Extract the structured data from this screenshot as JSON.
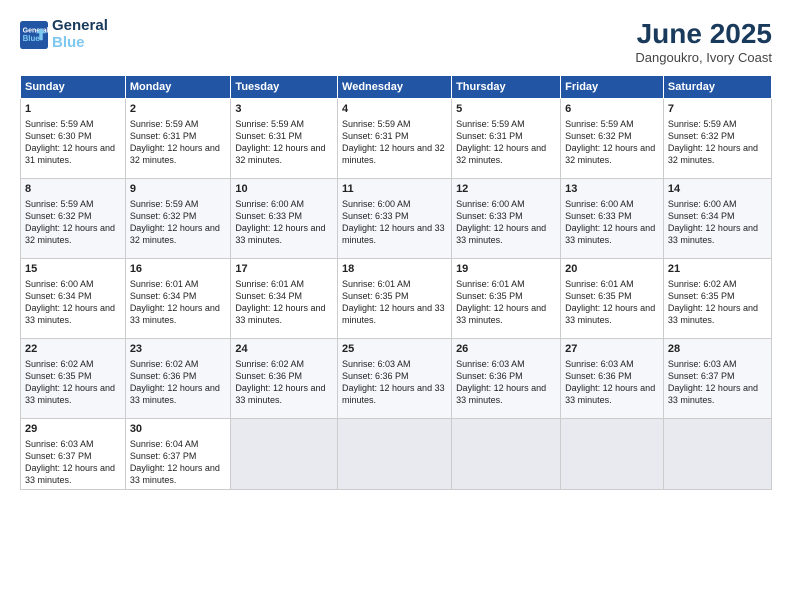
{
  "header": {
    "logo_line1": "General",
    "logo_line2": "Blue",
    "title": "June 2025",
    "subtitle": "Dangoukro, Ivory Coast"
  },
  "days_of_week": [
    "Sunday",
    "Monday",
    "Tuesday",
    "Wednesday",
    "Thursday",
    "Friday",
    "Saturday"
  ],
  "weeks": [
    [
      {
        "day": 1,
        "sunrise": "5:59 AM",
        "sunset": "6:30 PM",
        "daylight": "12 hours and 31 minutes."
      },
      {
        "day": 2,
        "sunrise": "5:59 AM",
        "sunset": "6:31 PM",
        "daylight": "12 hours and 32 minutes."
      },
      {
        "day": 3,
        "sunrise": "5:59 AM",
        "sunset": "6:31 PM",
        "daylight": "12 hours and 32 minutes."
      },
      {
        "day": 4,
        "sunrise": "5:59 AM",
        "sunset": "6:31 PM",
        "daylight": "12 hours and 32 minutes."
      },
      {
        "day": 5,
        "sunrise": "5:59 AM",
        "sunset": "6:31 PM",
        "daylight": "12 hours and 32 minutes."
      },
      {
        "day": 6,
        "sunrise": "5:59 AM",
        "sunset": "6:32 PM",
        "daylight": "12 hours and 32 minutes."
      },
      {
        "day": 7,
        "sunrise": "5:59 AM",
        "sunset": "6:32 PM",
        "daylight": "12 hours and 32 minutes."
      }
    ],
    [
      {
        "day": 8,
        "sunrise": "5:59 AM",
        "sunset": "6:32 PM",
        "daylight": "12 hours and 32 minutes."
      },
      {
        "day": 9,
        "sunrise": "5:59 AM",
        "sunset": "6:32 PM",
        "daylight": "12 hours and 32 minutes."
      },
      {
        "day": 10,
        "sunrise": "6:00 AM",
        "sunset": "6:33 PM",
        "daylight": "12 hours and 33 minutes."
      },
      {
        "day": 11,
        "sunrise": "6:00 AM",
        "sunset": "6:33 PM",
        "daylight": "12 hours and 33 minutes."
      },
      {
        "day": 12,
        "sunrise": "6:00 AM",
        "sunset": "6:33 PM",
        "daylight": "12 hours and 33 minutes."
      },
      {
        "day": 13,
        "sunrise": "6:00 AM",
        "sunset": "6:33 PM",
        "daylight": "12 hours and 33 minutes."
      },
      {
        "day": 14,
        "sunrise": "6:00 AM",
        "sunset": "6:34 PM",
        "daylight": "12 hours and 33 minutes."
      }
    ],
    [
      {
        "day": 15,
        "sunrise": "6:00 AM",
        "sunset": "6:34 PM",
        "daylight": "12 hours and 33 minutes."
      },
      {
        "day": 16,
        "sunrise": "6:01 AM",
        "sunset": "6:34 PM",
        "daylight": "12 hours and 33 minutes."
      },
      {
        "day": 17,
        "sunrise": "6:01 AM",
        "sunset": "6:34 PM",
        "daylight": "12 hours and 33 minutes."
      },
      {
        "day": 18,
        "sunrise": "6:01 AM",
        "sunset": "6:35 PM",
        "daylight": "12 hours and 33 minutes."
      },
      {
        "day": 19,
        "sunrise": "6:01 AM",
        "sunset": "6:35 PM",
        "daylight": "12 hours and 33 minutes."
      },
      {
        "day": 20,
        "sunrise": "6:01 AM",
        "sunset": "6:35 PM",
        "daylight": "12 hours and 33 minutes."
      },
      {
        "day": 21,
        "sunrise": "6:02 AM",
        "sunset": "6:35 PM",
        "daylight": "12 hours and 33 minutes."
      }
    ],
    [
      {
        "day": 22,
        "sunrise": "6:02 AM",
        "sunset": "6:35 PM",
        "daylight": "12 hours and 33 minutes."
      },
      {
        "day": 23,
        "sunrise": "6:02 AM",
        "sunset": "6:36 PM",
        "daylight": "12 hours and 33 minutes."
      },
      {
        "day": 24,
        "sunrise": "6:02 AM",
        "sunset": "6:36 PM",
        "daylight": "12 hours and 33 minutes."
      },
      {
        "day": 25,
        "sunrise": "6:03 AM",
        "sunset": "6:36 PM",
        "daylight": "12 hours and 33 minutes."
      },
      {
        "day": 26,
        "sunrise": "6:03 AM",
        "sunset": "6:36 PM",
        "daylight": "12 hours and 33 minutes."
      },
      {
        "day": 27,
        "sunrise": "6:03 AM",
        "sunset": "6:36 PM",
        "daylight": "12 hours and 33 minutes."
      },
      {
        "day": 28,
        "sunrise": "6:03 AM",
        "sunset": "6:37 PM",
        "daylight": "12 hours and 33 minutes."
      }
    ],
    [
      {
        "day": 29,
        "sunrise": "6:03 AM",
        "sunset": "6:37 PM",
        "daylight": "12 hours and 33 minutes."
      },
      {
        "day": 30,
        "sunrise": "6:04 AM",
        "sunset": "6:37 PM",
        "daylight": "12 hours and 33 minutes."
      },
      null,
      null,
      null,
      null,
      null
    ]
  ]
}
